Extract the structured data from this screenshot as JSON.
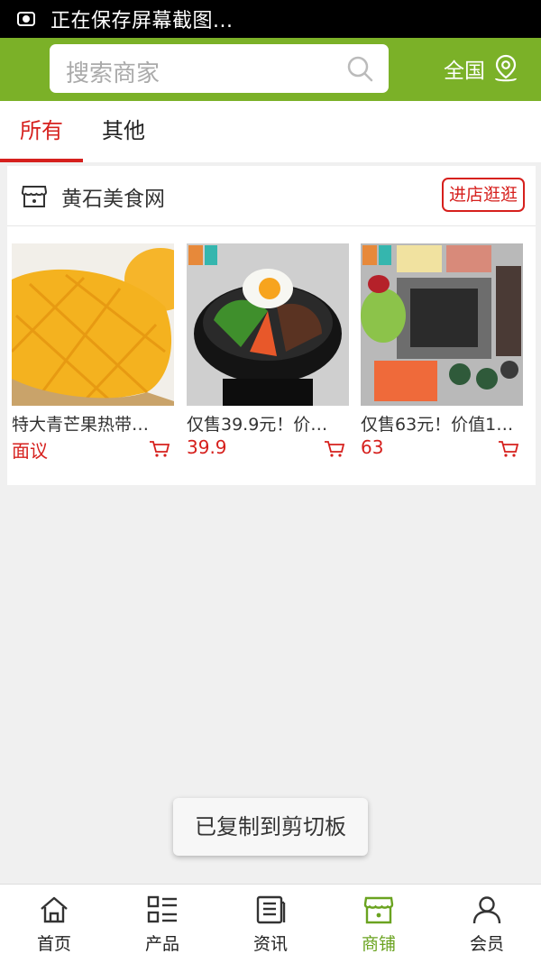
{
  "status_bar": {
    "text": "正在保存屏幕截图..."
  },
  "header": {
    "search_placeholder": "搜索商家",
    "region_label": "全国"
  },
  "tabs": [
    {
      "label": "所有",
      "active": true
    },
    {
      "label": "其他",
      "active": false
    }
  ],
  "store": {
    "name": "黄石美食网",
    "visit_label": "进店逛逛",
    "products": [
      {
        "title": "特大青芒果热带…",
        "price": "面议"
      },
      {
        "title": "仅售39.9元！价…",
        "price": "39.9"
      },
      {
        "title": "仅售63元！价值1…",
        "price": "63"
      }
    ]
  },
  "toast": {
    "text": "已复制到剪切板"
  },
  "bottom_nav": [
    {
      "label": "首页",
      "icon": "home-icon"
    },
    {
      "label": "产品",
      "icon": "list-icon"
    },
    {
      "label": "资讯",
      "icon": "news-icon"
    },
    {
      "label": "商铺",
      "icon": "shop-icon",
      "active": true
    },
    {
      "label": "会员",
      "icon": "user-icon"
    }
  ],
  "colors": {
    "brand_green": "#7bb128",
    "accent_red": "#d6201d",
    "nav_active_green": "#6aa320"
  }
}
